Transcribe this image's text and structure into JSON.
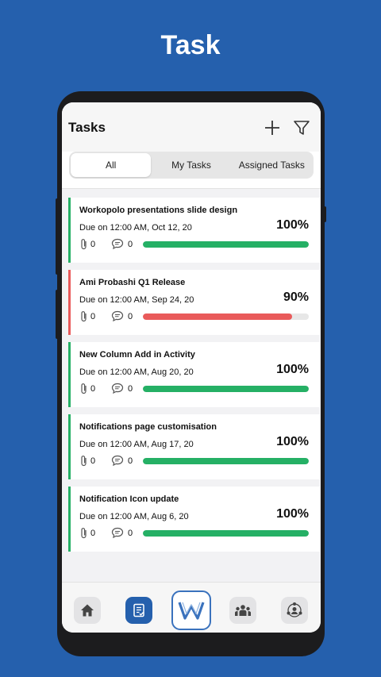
{
  "hero": {
    "title": "Task"
  },
  "header": {
    "title": "Tasks",
    "add_icon": "plus-icon",
    "filter_icon": "funnel-icon"
  },
  "tabs": [
    {
      "label": "All",
      "active": true
    },
    {
      "label": "My Tasks",
      "active": false
    },
    {
      "label": "Assigned Tasks",
      "active": false
    }
  ],
  "colors": {
    "brand": "#2560ad",
    "complete": "#25b065",
    "behind": "#e95a5a"
  },
  "tasks": [
    {
      "title": "Workopolo presentations slide design",
      "due": "Due on 12:00 AM, Oct 12, 20",
      "percent_label": "100%",
      "progress": 1.0,
      "attachments": "0",
      "comments": "0",
      "status": "complete"
    },
    {
      "title": "Ami Probashi Q1 Release",
      "due": "Due on 12:00 AM, Sep 24, 20",
      "percent_label": "90%",
      "progress": 0.9,
      "attachments": "0",
      "comments": "0",
      "status": "behind"
    },
    {
      "title": "New Column Add in Activity",
      "due": "Due on 12:00 AM, Aug 20, 20",
      "percent_label": "100%",
      "progress": 1.0,
      "attachments": "0",
      "comments": "0",
      "status": "complete"
    },
    {
      "title": "Notifications page customisation",
      "due": "Due on 12:00 AM, Aug 17, 20",
      "percent_label": "100%",
      "progress": 1.0,
      "attachments": "0",
      "comments": "0",
      "status": "complete"
    },
    {
      "title": "Notification Icon update",
      "due": "Due on 12:00 AM, Aug 6, 20",
      "percent_label": "100%",
      "progress": 1.0,
      "attachments": "0",
      "comments": "0",
      "status": "complete"
    }
  ],
  "bottom_nav": [
    {
      "icon": "home-icon",
      "active": false
    },
    {
      "icon": "task-list-icon",
      "active": true
    },
    {
      "icon": "app-logo-icon",
      "active": false
    },
    {
      "icon": "team-icon",
      "active": false
    },
    {
      "icon": "organization-icon",
      "active": false
    }
  ]
}
